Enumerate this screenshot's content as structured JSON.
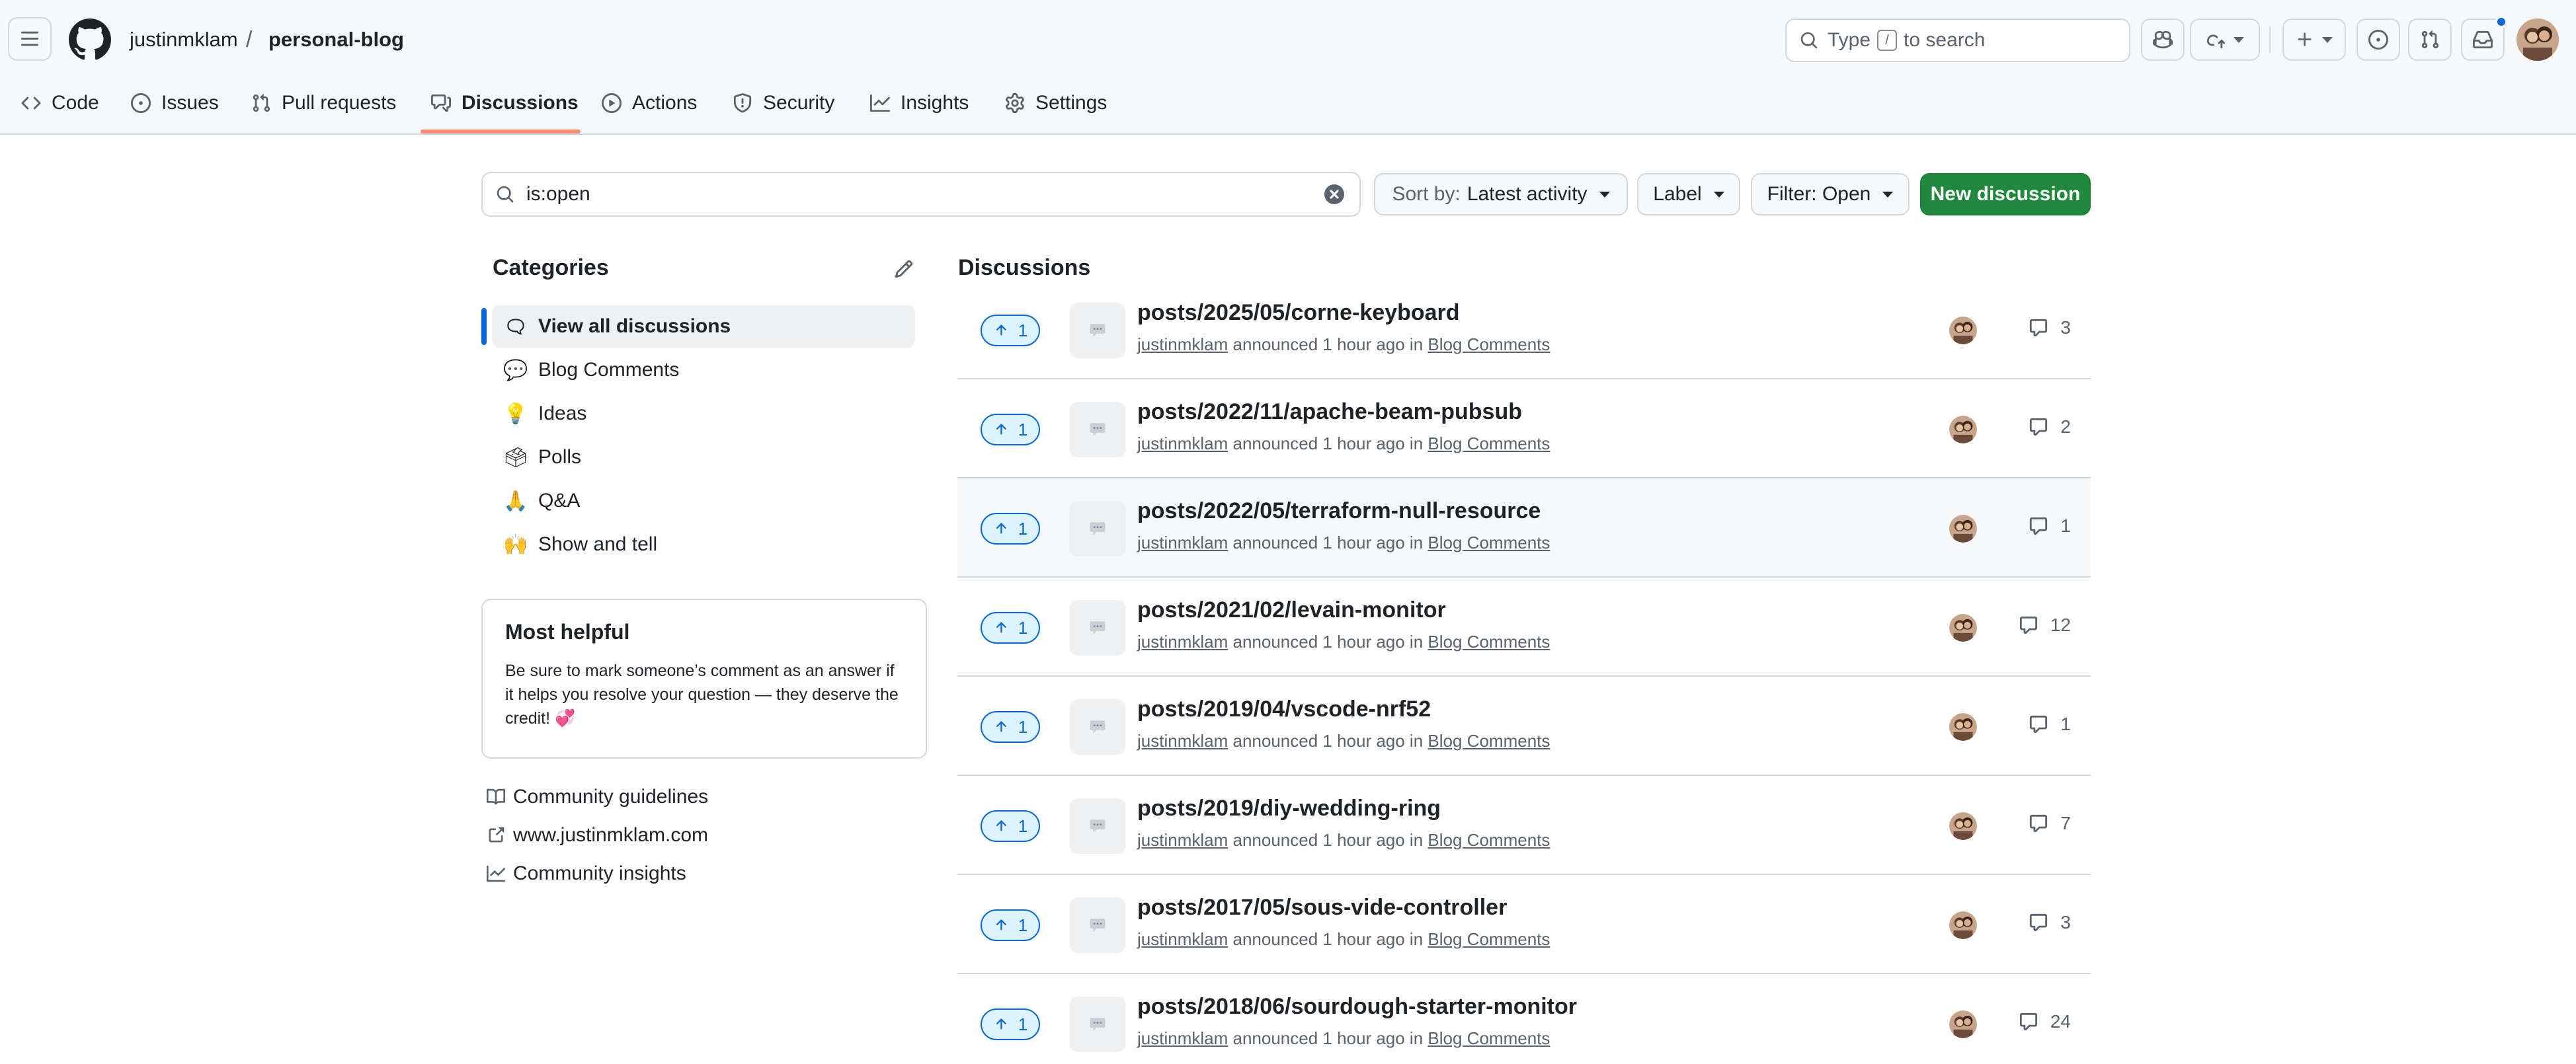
{
  "header": {
    "owner": "justinmklam",
    "separator": "/",
    "repo": "personal-blog",
    "search_prefix": "Type",
    "search_key": "/",
    "search_suffix": "to search"
  },
  "tabs": [
    {
      "label": "Code",
      "icon": "code-icon"
    },
    {
      "label": "Issues",
      "icon": "issue-icon"
    },
    {
      "label": "Pull requests",
      "icon": "pull-request-icon"
    },
    {
      "label": "Discussions",
      "icon": "discussions-icon",
      "active": true
    },
    {
      "label": "Actions",
      "icon": "play-icon"
    },
    {
      "label": "Security",
      "icon": "shield-icon"
    },
    {
      "label": "Insights",
      "icon": "graph-icon"
    },
    {
      "label": "Settings",
      "icon": "gear-icon"
    }
  ],
  "filter": {
    "query": "is:open",
    "sort_label": "Sort by:",
    "sort_value": "Latest activity",
    "label_button": "Label",
    "filter_button": "Filter: Open",
    "new_discussion": "New discussion"
  },
  "sidebar": {
    "title": "Categories",
    "categories": [
      {
        "emoji": "🗨",
        "label": "View all discussions",
        "active": true
      },
      {
        "emoji": "💬",
        "label": "Blog Comments"
      },
      {
        "emoji": "💡",
        "label": "Ideas"
      },
      {
        "emoji": "🗳",
        "label": "Polls"
      },
      {
        "emoji": "🙏",
        "label": "Q&A"
      },
      {
        "emoji": "🙌",
        "label": "Show and tell"
      }
    ],
    "most_helpful": {
      "title": "Most helpful",
      "body": "Be sure to mark someone’s comment as an answer if it helps you resolve your question — they deserve the credit! 💞"
    },
    "links": [
      {
        "label": "Community guidelines",
        "icon": "book-icon"
      },
      {
        "label": "www.justinmklam.com",
        "icon": "external-link-icon"
      },
      {
        "label": "Community insights",
        "icon": "graph-icon"
      }
    ]
  },
  "discussions": {
    "title": "Discussions",
    "items": [
      {
        "title": "posts/2025/05/corne-keyboard",
        "author": "justinmklam",
        "action": "announced 1 hour ago in",
        "category": "Blog Comments",
        "upvotes": "1",
        "comments": "3"
      },
      {
        "title": "posts/2022/11/apache-beam-pubsub",
        "author": "justinmklam",
        "action": "announced 1 hour ago in",
        "category": "Blog Comments",
        "upvotes": "1",
        "comments": "2"
      },
      {
        "title": "posts/2022/05/terraform-null-resource",
        "author": "justinmklam",
        "action": "announced 1 hour ago in",
        "category": "Blog Comments",
        "upvotes": "1",
        "comments": "1"
      },
      {
        "title": "posts/2021/02/levain-monitor",
        "author": "justinmklam",
        "action": "announced 1 hour ago in",
        "category": "Blog Comments",
        "upvotes": "1",
        "comments": "12"
      },
      {
        "title": "posts/2019/04/vscode-nrf52",
        "author": "justinmklam",
        "action": "announced 1 hour ago in",
        "category": "Blog Comments",
        "upvotes": "1",
        "comments": "1"
      },
      {
        "title": "posts/2019/diy-wedding-ring",
        "author": "justinmklam",
        "action": "announced 1 hour ago in",
        "category": "Blog Comments",
        "upvotes": "1",
        "comments": "7"
      },
      {
        "title": "posts/2017/05/sous-vide-controller",
        "author": "justinmklam",
        "action": "announced 1 hour ago in",
        "category": "Blog Comments",
        "upvotes": "1",
        "comments": "3"
      },
      {
        "title": "posts/2018/06/sourdough-starter-monitor",
        "author": "justinmklam",
        "action": "announced 1 hour ago in",
        "category": "Blog Comments",
        "upvotes": "1",
        "comments": "24"
      }
    ]
  },
  "colors": {
    "accent": "#0969da",
    "primary_button": "#1f883d",
    "tab_underline": "#fd8c73"
  }
}
